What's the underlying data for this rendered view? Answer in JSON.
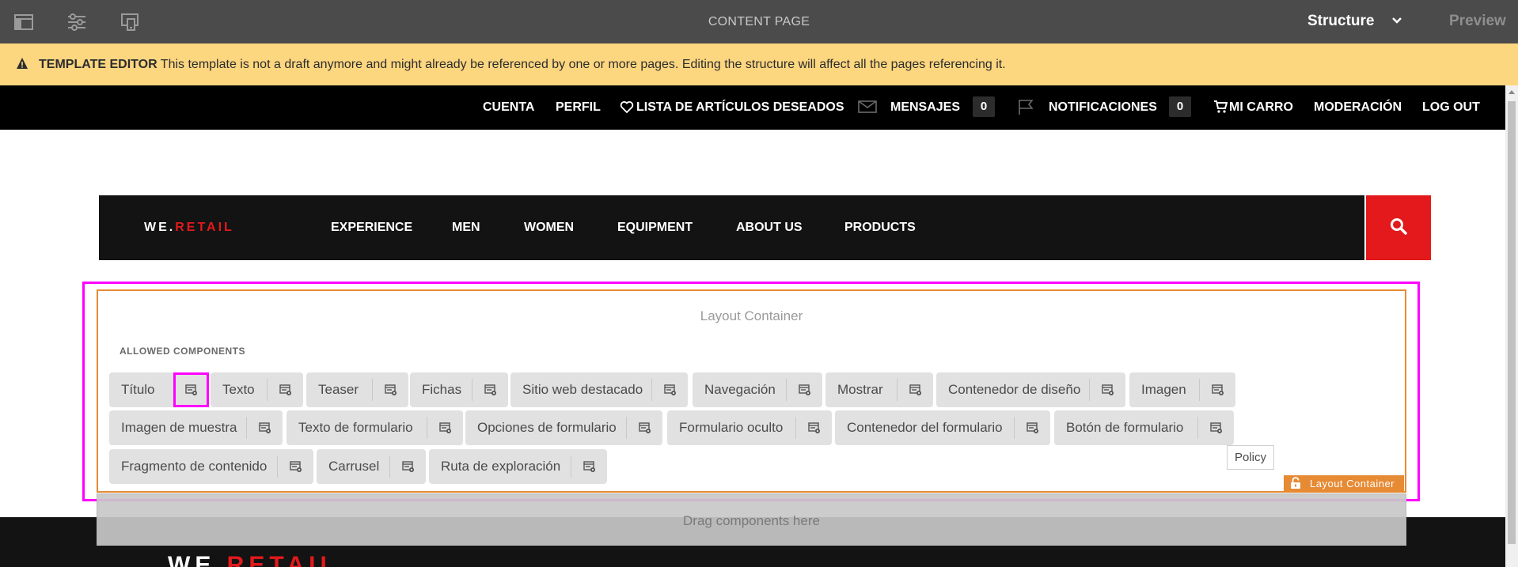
{
  "editor": {
    "page_title": "CONTENT PAGE",
    "mode": "Structure",
    "preview_label": "Preview",
    "icons": [
      "side-panel-icon",
      "page-properties-icon",
      "emulator-icon"
    ]
  },
  "banner": {
    "label": "TEMPLATE EDITOR",
    "message": "This template is not a draft anymore and might already be referenced by one or more pages. Editing the structure will affect all the pages referencing it.",
    "color": "#fdd680"
  },
  "utility_nav": {
    "cuenta": "CUENTA",
    "perfil": "PERFIL",
    "wishlist": "LISTA DE ARTÍCULOS DESEADOS",
    "mensajes": "MENSAJES",
    "mensajes_count": "0",
    "notificaciones": "NOTIFICACIONES",
    "notificaciones_count": "0",
    "carro": "MI CARRO",
    "moderacion": "MODERACIÓN",
    "logout": "LOG OUT"
  },
  "main_nav": {
    "logo_we": "WE.",
    "logo_retail": "RETAIL",
    "items": [
      "EXPERIENCE",
      "MEN",
      "WOMEN",
      "EQUIPMENT",
      "ABOUT US",
      "PRODUCTS"
    ],
    "accent": "#e3191b"
  },
  "layout_container": {
    "title": "Layout Container",
    "allowed_title": "ALLOWED COMPONENTS",
    "components": [
      "Título",
      "Texto",
      "Teaser",
      "Fichas",
      "Sitio web destacado",
      "Navegación",
      "Mostrar",
      "Contenedor de diseño",
      "Imagen",
      "Imagen de muestra",
      "Texto de formulario",
      "Opciones de formulario",
      "Formulario oculto",
      "Contenedor del formulario",
      "Botón de formulario",
      "Fragmento de contenido",
      "Carrusel",
      "Ruta de exploración"
    ],
    "tooltip": "Policy",
    "tag_label": "Layout Container",
    "drag_text": "Drag components here",
    "highlight_color": "#ff00ff",
    "border_color": "#e68a34"
  },
  "footer": {
    "logo_we": "WE.",
    "logo_retail": "RETAIL"
  }
}
